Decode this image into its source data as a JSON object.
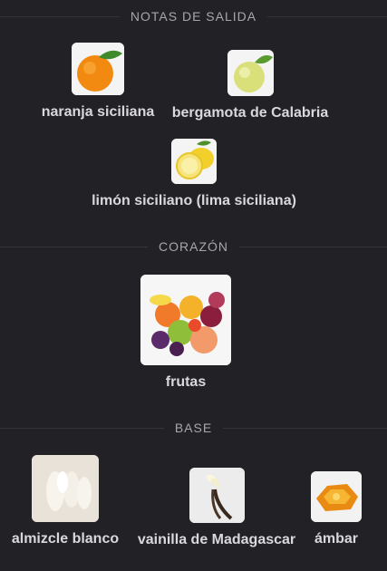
{
  "sections": {
    "top": {
      "title": "NOTAS DE SALIDA",
      "items": [
        {
          "name": "naranja siciliana",
          "icon": "orange-icon"
        },
        {
          "name": "bergamota de Calabria",
          "icon": "bergamot-icon"
        },
        {
          "name": "limón siciliano (lima siciliana)",
          "icon": "lemon-icon"
        }
      ]
    },
    "heart": {
      "title": "CORAZÓN",
      "items": [
        {
          "name": "frutas",
          "icon": "fruits-icon"
        }
      ]
    },
    "base": {
      "title": "BASE",
      "items": [
        {
          "name": "almizcle blanco",
          "icon": "white-musk-icon"
        },
        {
          "name": "vainilla de Madagascar",
          "icon": "vanilla-icon"
        },
        {
          "name": "ámbar",
          "icon": "amber-icon"
        }
      ]
    }
  },
  "colors": {
    "background": "#222226",
    "divider": "#34343a",
    "header_text": "#a6a6ad",
    "item_text": "#d9d9dd"
  }
}
